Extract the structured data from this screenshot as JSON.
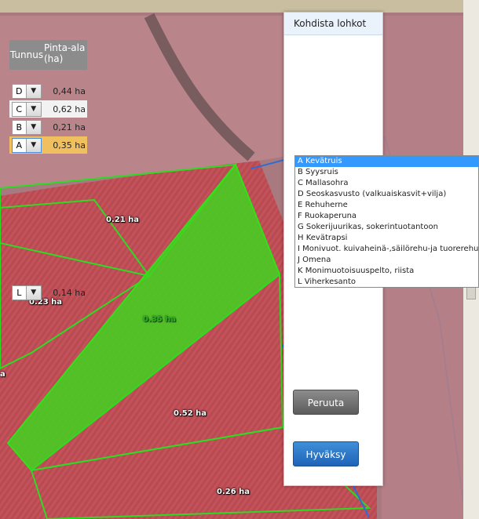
{
  "map": {
    "labels": [
      {
        "id": "l1",
        "text": "0.21 ha"
      },
      {
        "id": "l2",
        "text": "0.23 ha"
      },
      {
        "id": "l3",
        "text": "0.35 ha"
      },
      {
        "id": "l4",
        "text": "0.52 ha"
      },
      {
        "id": "l5",
        "text": "0.26 ha"
      },
      {
        "id": "l6",
        "text": "a"
      }
    ]
  },
  "panel": {
    "title": "Kohdista lohkot",
    "col_tunnus": "Tunnus",
    "col_area": "Pinta-ala (ha)",
    "rows": [
      {
        "code": "D",
        "area": "0,44 ha"
      },
      {
        "code": "C",
        "area": "0,62 ha"
      },
      {
        "code": "B",
        "area": "0,21 ha"
      },
      {
        "code": "A",
        "area": "0,35 ha"
      },
      {
        "code": "L",
        "area": "0,14 ha"
      }
    ],
    "dropdown_options": [
      "A Kevätruis",
      "B Syysruis",
      "C Mallasohra",
      "D Seoskasvusto (valkuaiskasvit+vilja)",
      "E Rehuherne",
      "F Ruokaperuna",
      "G Sokerijuurikas, sokerintuotantoon",
      "H Kevätrapsi",
      "I Monivuot. kuivaheinä-,säilörehu-ja tuorerehu",
      "J Omena",
      "K Monimuotoisuuspelto, riista",
      "L Viherkesanto"
    ],
    "cancel_label": "Peruuta",
    "ok_label": "Hyväksy"
  },
  "colors": {
    "selected_row": "#f0c060",
    "highlight": "#3399ff",
    "parcel_fill": "#3fd41f",
    "parcel_border": "#33e01a"
  }
}
